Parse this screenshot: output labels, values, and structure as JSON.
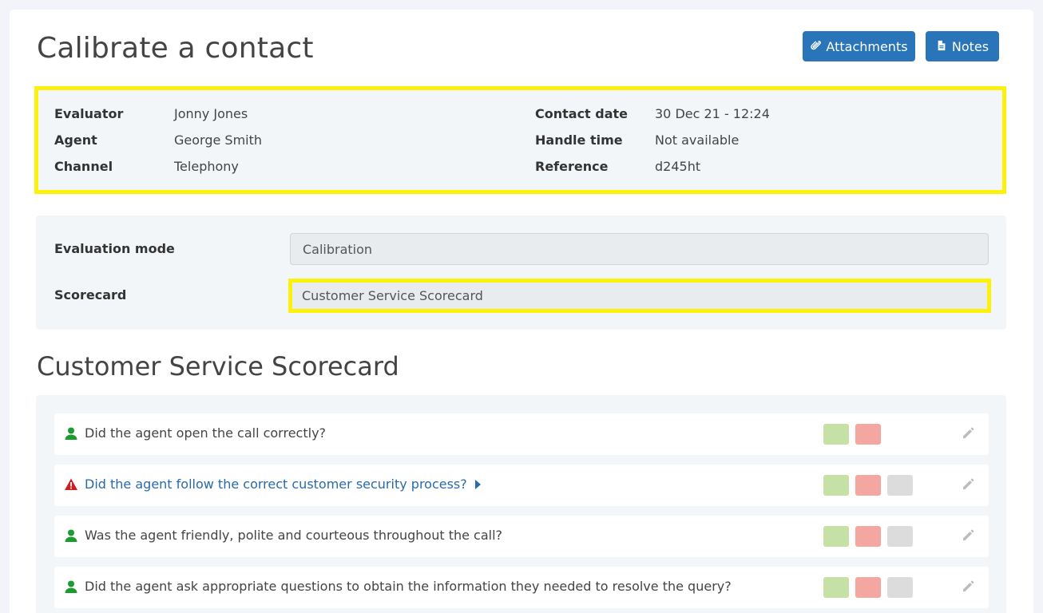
{
  "header": {
    "title": "Calibrate a contact",
    "attachments_label": "Attachments",
    "notes_label": "Notes",
    "button_color": "#2a74ba"
  },
  "info": {
    "evaluator_label": "Evaluator",
    "evaluator_value": "Jonny Jones",
    "agent_label": "Agent",
    "agent_value": "George Smith",
    "channel_label": "Channel",
    "channel_value": "Telephony",
    "contact_date_label": "Contact date",
    "contact_date_value": "30 Dec 21 - 12:24",
    "handle_time_label": "Handle time",
    "handle_time_value": "Not available",
    "reference_label": "Reference",
    "reference_value": "d245ht",
    "highlight_color": "#fcf10a"
  },
  "evaluation": {
    "mode_label": "Evaluation mode",
    "mode_value": "Calibration",
    "scorecard_label": "Scorecard",
    "scorecard_value": "Customer Service Scorecard"
  },
  "scorecard": {
    "title": "Customer Service Scorecard",
    "colors": {
      "yes": "#c5e1a5",
      "no": "#f4a6a0",
      "na": "#dcdcdc",
      "user_icon": "#1e9b2e",
      "warning_icon": "#cc1f1f"
    },
    "questions": [
      {
        "text": "Did the agent open the call correctly?",
        "icon": "user-icon",
        "options": [
          "yes",
          "no"
        ]
      },
      {
        "text": "Did the agent follow the correct customer security process?",
        "icon": "warning-icon",
        "options": [
          "yes",
          "no",
          "na"
        ]
      },
      {
        "text": "Was the agent friendly, polite and courteous throughout the call?",
        "icon": "user-icon",
        "options": [
          "yes",
          "no",
          "na"
        ]
      },
      {
        "text": "Did the agent ask appropriate questions to obtain the information they needed to resolve the query?",
        "icon": "user-icon",
        "options": [
          "yes",
          "no",
          "na"
        ]
      }
    ]
  }
}
